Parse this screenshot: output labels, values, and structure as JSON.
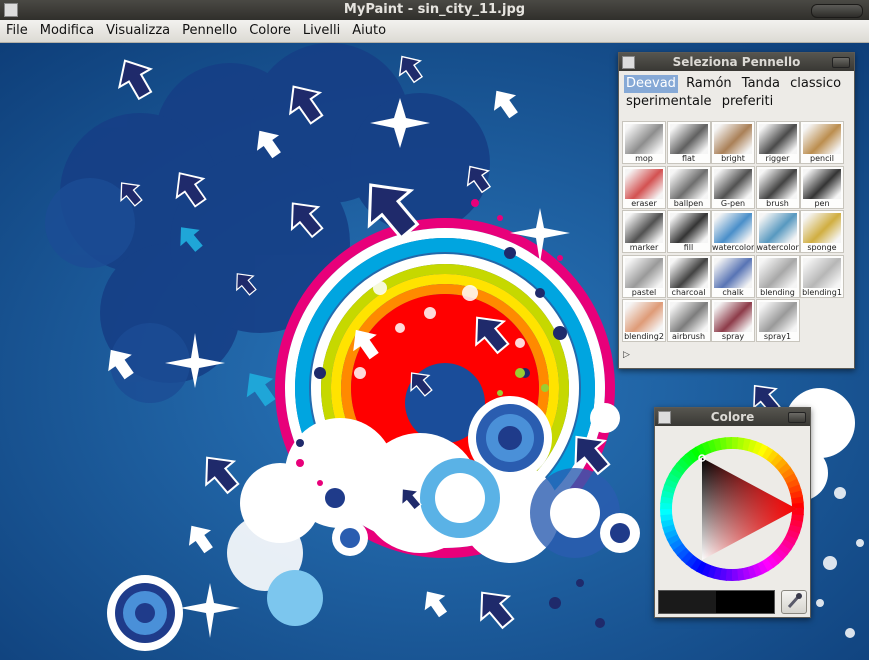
{
  "window": {
    "title": "MyPaint - sin_city_11.jpg"
  },
  "menu": [
    "File",
    "Modifica",
    "Visualizza",
    "Pennello",
    "Colore",
    "Livelli",
    "Aiuto"
  ],
  "brush_panel": {
    "title": "Seleziona Pennello",
    "groups": [
      "Deevad",
      "Ramón",
      "Tanda",
      "classico",
      "sperimentale",
      "preferiti"
    ],
    "active_group": "Deevad",
    "brushes": [
      "mop",
      "flat",
      "bright",
      "rigger",
      "pencil",
      "eraser",
      "ballpen",
      "G-pen",
      "brush",
      "pen",
      "marker",
      "fill",
      "watercolor",
      "watercolor1",
      "sponge",
      "pastel",
      "charcoal",
      "chalk",
      "blending",
      "blending1",
      "blending2",
      "airbrush",
      "spray",
      "spray1"
    ],
    "expander_icon": "triangle-right-icon"
  },
  "color_panel": {
    "title": "Colore",
    "current_color": "#000000",
    "previous_color": "#1a1a1a",
    "picker_icon": "eyedropper-icon"
  },
  "colors": {
    "canvas_bg": "#0e3d7a",
    "rainbow": [
      "#e8007a",
      "#ffffff",
      "#00a5e0",
      "#ffffff",
      "#c6d800",
      "#ffe300",
      "#ff8a00",
      "#ff0000"
    ],
    "arrow_dark": "#1f2a6b",
    "arrow_light": "#ffffff"
  }
}
